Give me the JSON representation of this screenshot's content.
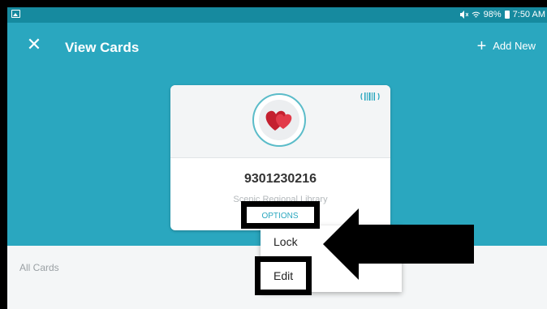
{
  "status_bar": {
    "battery": "98%",
    "time": "7:50 AM"
  },
  "app_bar": {
    "title": "View Cards",
    "add_new_label": "Add New"
  },
  "card": {
    "number": "9301230216",
    "library_name": "Scenic Regional Library",
    "options_label": "OPTIONS"
  },
  "options_menu": {
    "items": [
      "Lock",
      "Edit"
    ]
  },
  "section_label": "All Cards",
  "colors": {
    "primary": "#2aa7bf",
    "status_bar": "#168a9f",
    "heart": "#e23b4a"
  },
  "icons": [
    "gallery-icon",
    "mute-icon",
    "wifi-icon",
    "battery-icon",
    "close-icon",
    "plus-icon",
    "barcode-icon",
    "heart-logo-icon"
  ]
}
